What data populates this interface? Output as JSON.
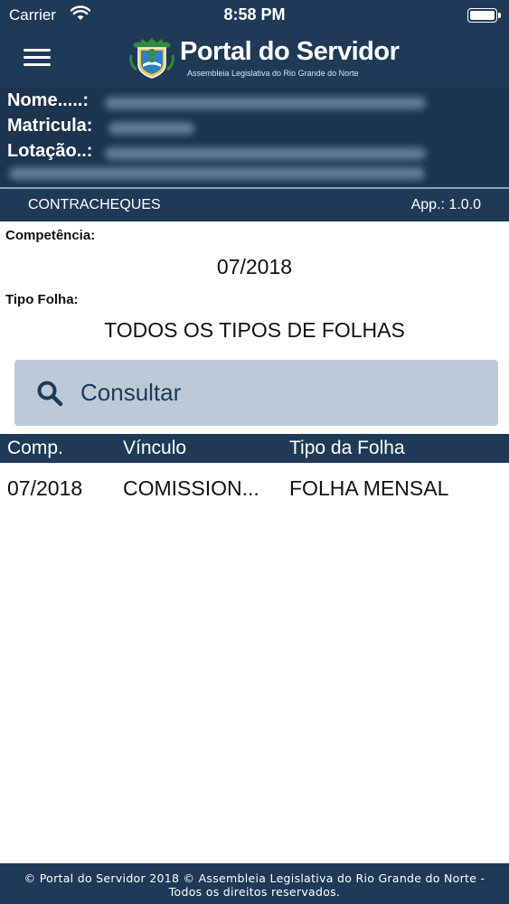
{
  "status_bar": {
    "carrier": "Carrier",
    "time": "8:58 PM",
    "wifi_icon": "wifi-icon",
    "battery_icon": "battery-icon"
  },
  "header": {
    "menu_icon": "hamburger-menu-icon",
    "logo_icon": "crest-icon",
    "title": "Portal do Servidor",
    "subtitle": "Assembleia Legislativa do Rio Grande do Norte"
  },
  "user_info": {
    "name_label": "Nome.....:",
    "matricula_label": "Matricula:",
    "lotacao_label": "Lotação..:"
  },
  "section": {
    "title": "CONTRACHEQUES",
    "version": "App.: 1.0.0"
  },
  "form": {
    "competencia_label": "Competência:",
    "competencia_value": "07/2018",
    "tipo_folha_label": "Tipo Folha:",
    "tipo_folha_value": "TODOS OS TIPOS DE FOLHAS",
    "consult_button": "Consultar",
    "consult_icon": "search-icon"
  },
  "table": {
    "columns": [
      "Comp.",
      "Vínculo",
      "Tipo da Folha"
    ],
    "rows": [
      [
        "07/2018",
        "COMISSION...",
        "FOLHA MENSAL"
      ]
    ]
  },
  "footer": {
    "line1": "© Portal do Servidor 2018 © Assembleia Legislativa do Rio Grande do Norte -",
    "line2": "Todos os direitos reservados."
  },
  "colors": {
    "primary": "#1e3a57",
    "info_bg": "#1c344d",
    "button_bg": "#bccad7"
  }
}
